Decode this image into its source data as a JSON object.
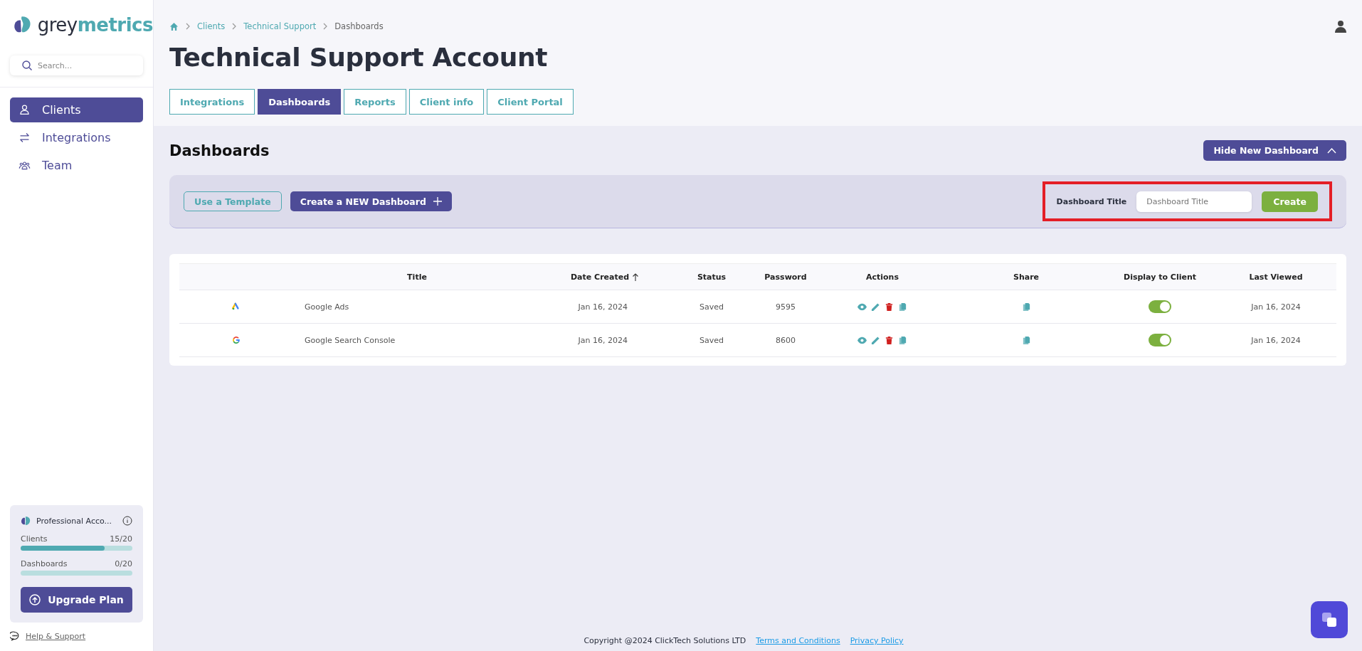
{
  "sidebar": {
    "logo": {
      "plain": "grey",
      "accent": "metrics"
    },
    "search": {
      "placeholder": "Search..."
    },
    "nav": [
      {
        "label": "Clients",
        "kind": "user",
        "selected": true
      },
      {
        "label": "Integrations",
        "kind": "swap",
        "selected": false
      },
      {
        "label": "Team",
        "kind": "team",
        "selected": false
      }
    ],
    "plan": {
      "name": "Professional Acco...",
      "meters": [
        {
          "label": "Clients",
          "reading": "15/20",
          "level": 0.75
        },
        {
          "label": "Dashboards",
          "reading": "0/20"
        }
      ],
      "upgrade": "Upgrade Plan"
    },
    "help": "Help & Support"
  },
  "breadcrumb": [
    "Clients",
    "Technical Support",
    "Dashboards"
  ],
  "title": "Technical Support Account",
  "tabs": [
    {
      "label": "Integrations",
      "selected": false
    },
    {
      "label": "Dashboards",
      "selected": true
    },
    {
      "label": "Reports",
      "selected": false
    },
    {
      "label": "Client info",
      "selected": false
    },
    {
      "label": "Client Portal",
      "selected": false
    }
  ],
  "section": {
    "title": "Dashboards",
    "toggle_button": "Hide New Dashboard"
  },
  "panel": {
    "template_button": "Use a Template",
    "new_button": "Create a NEW Dashboard",
    "title_field": {
      "label": "Dashboard Title",
      "placeholder": "Dashboard Title",
      "highlighted": true
    },
    "create_button": "Create"
  },
  "table": {
    "columns": [
      {
        "label": "Title",
        "sorted": false
      },
      {
        "label": "Date Created",
        "sorted": true
      },
      {
        "label": "Status",
        "sorted": false
      },
      {
        "label": "Password",
        "sorted": false
      },
      {
        "label": "Actions",
        "sorted": false
      },
      {
        "label": "Share",
        "sorted": false
      },
      {
        "label": "Display to Client",
        "sorted": false
      },
      {
        "label": "Last Viewed",
        "sorted": false
      }
    ],
    "rows": [
      {
        "kind": "ads",
        "title": "Google Ads",
        "date_created": "Jan 16, 2024",
        "status": "Saved",
        "password": "9595",
        "display_to_client": true,
        "last_viewed": "Jan 16, 2024"
      },
      {
        "kind": "search",
        "title": "Google Search Console",
        "date_created": "Jan 16, 2024",
        "status": "Saved",
        "password": "8600",
        "display_to_client": true,
        "last_viewed": "Jan 16, 2024"
      }
    ]
  },
  "footer": {
    "copyright": "Copyright @2024 ClickTech Solutions LTD",
    "links": [
      "Terms and Conditions",
      "Privacy Policy"
    ]
  }
}
